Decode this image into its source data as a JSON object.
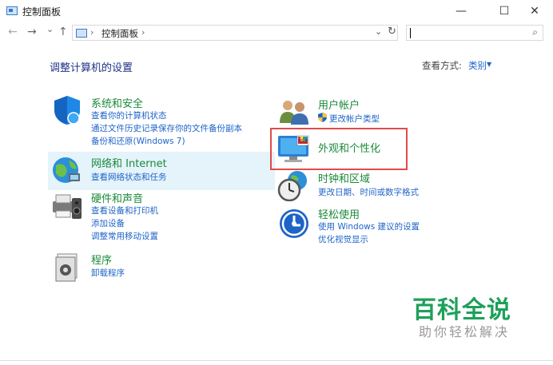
{
  "window": {
    "title": "控制面板",
    "minimize": "—",
    "maximize": "☐",
    "close": "✕"
  },
  "nav": {
    "back": "←",
    "forward": "→",
    "recent": "⌄",
    "up": "↑",
    "address_sep": "›",
    "address_text": "控制面板",
    "address_dropdown": "⌄",
    "refresh": "↻",
    "search_placeholder": "",
    "search_glyph": "⌕"
  },
  "content": {
    "title": "调整计算机的设置",
    "view_by_label": "查看方式:",
    "view_by_value": "类别",
    "view_by_caret": "▼"
  },
  "categories": [
    {
      "title": "系统和安全",
      "links": [
        "查看你的计算机状态",
        "通过文件历史记录保存你的文件备份副本",
        "备份和还原(Windows 7)"
      ]
    },
    {
      "title": "网络和 Internet",
      "links": [
        "查看网络状态和任务"
      ]
    },
    {
      "title": "硬件和声音",
      "links": [
        "查看设备和打印机",
        "添加设备",
        "调整常用移动设置"
      ]
    },
    {
      "title": "程序",
      "links": [
        "卸载程序"
      ]
    },
    {
      "title": "用户帐户",
      "links": [
        "更改帐户类型"
      ]
    },
    {
      "title": "外观和个性化",
      "links": []
    },
    {
      "title": "时钟和区域",
      "links": [
        "更改日期、时间或数字格式"
      ]
    },
    {
      "title": "轻松使用",
      "links": [
        "使用 Windows 建议的设置",
        "优化视觉显示"
      ]
    }
  ],
  "watermark": {
    "main": "百科全说",
    "sub": "助你轻松解决"
  },
  "colors": {
    "title_green": "#1a8a3a",
    "link_blue": "#1e64c8",
    "highlight": "#e5f3fb",
    "red_box": "#e04b4b",
    "watermark_green": "#1ea05a"
  }
}
